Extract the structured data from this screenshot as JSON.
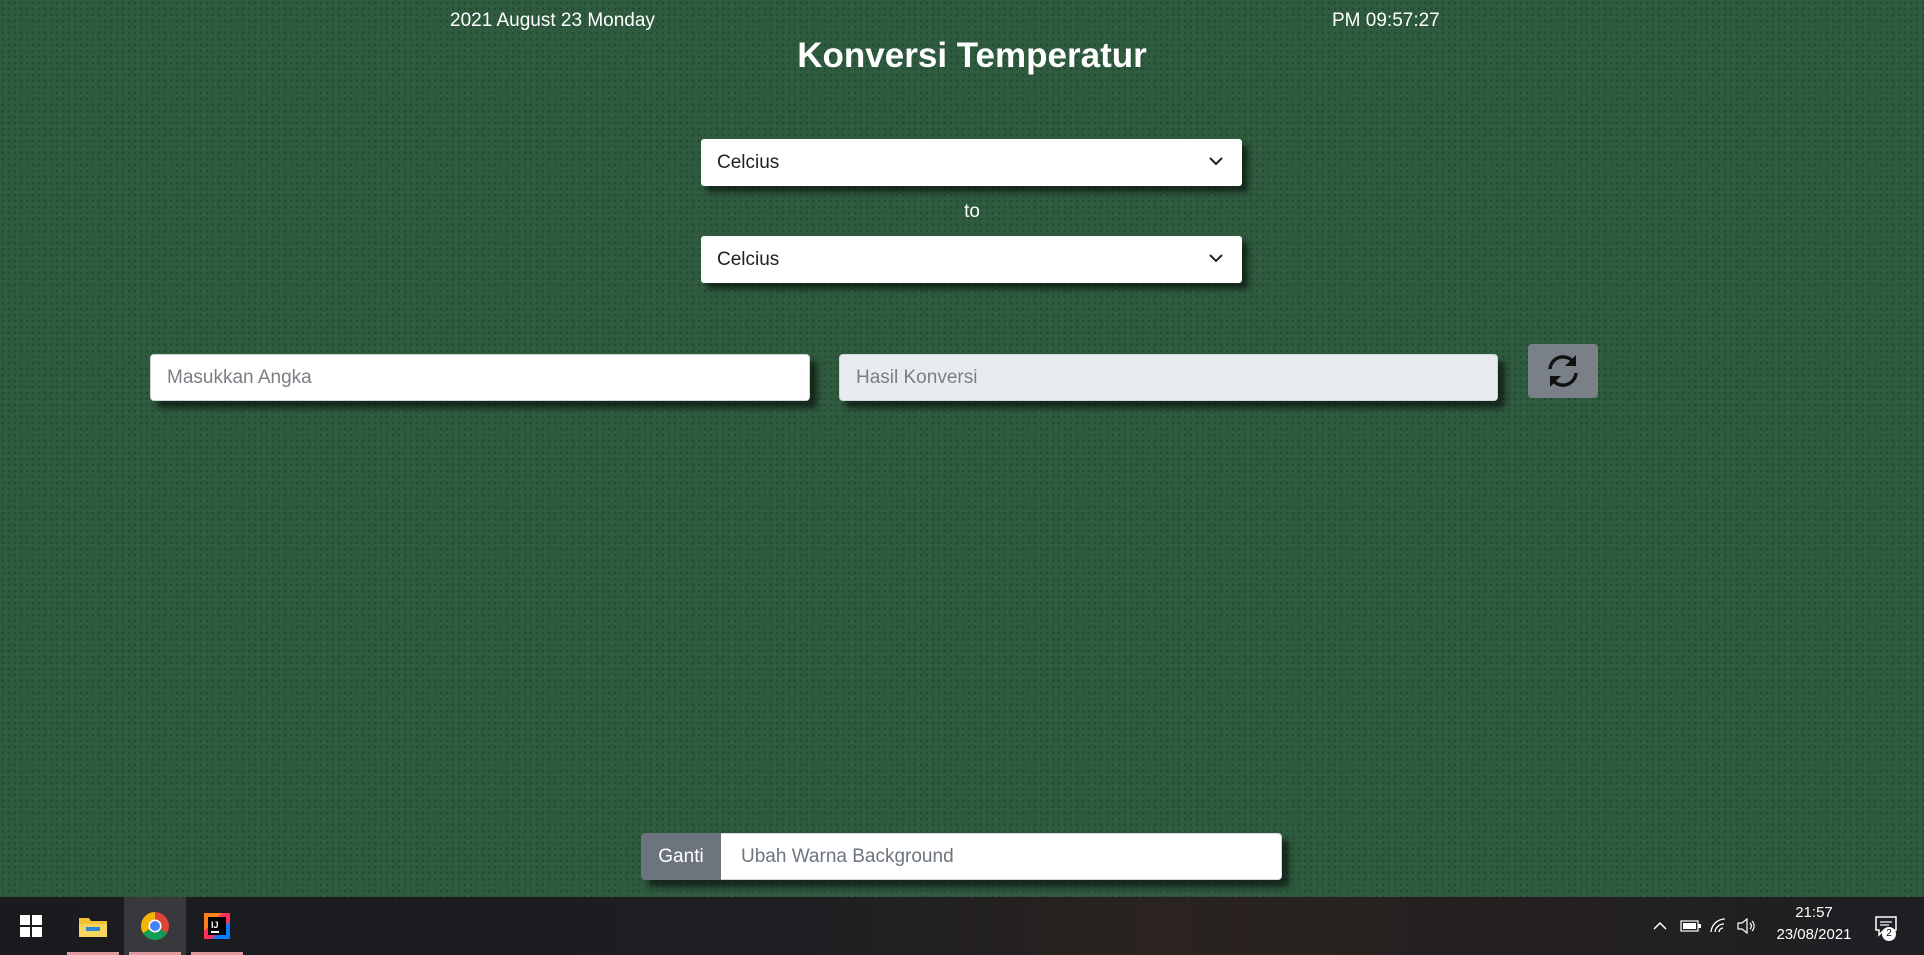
{
  "header": {
    "date": "2021 August 23 Monday",
    "time": "PM 09:57:27",
    "title": "Konversi Temperatur"
  },
  "converter": {
    "from_unit": "Celcius",
    "to_label": "to",
    "to_unit": "Celcius",
    "input_placeholder": "Masukkan Angka",
    "result_placeholder": "Hasil Konversi",
    "swap_icon": "refresh-icon"
  },
  "background_control": {
    "button_label": "Ganti",
    "input_placeholder": "Ubah Warna Background"
  },
  "taskbar": {
    "apps": [
      "start-icon",
      "file-explorer-icon",
      "chrome-icon",
      "intellij-icon"
    ],
    "clock_time": "21:57",
    "clock_date": "23/08/2021",
    "notification_count": "2"
  },
  "colors": {
    "background": "#2e5a3e",
    "swap_button": "#7a8088",
    "ganti_button": "#6c757d"
  }
}
